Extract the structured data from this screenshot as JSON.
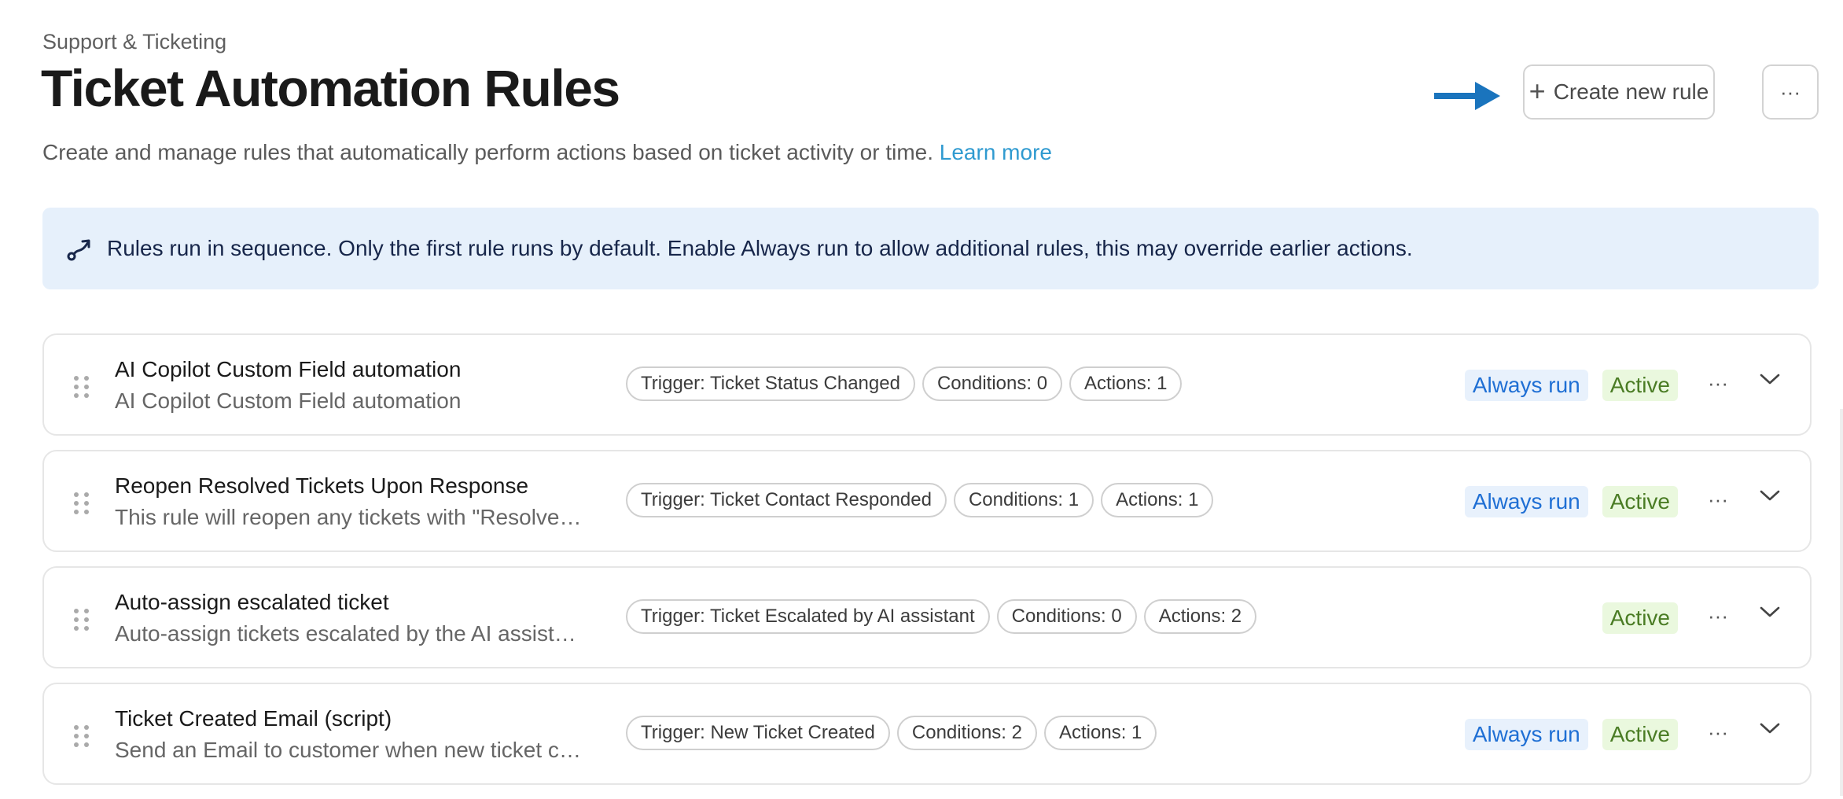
{
  "header": {
    "breadcrumb": "Support & Ticketing",
    "title": "Ticket Automation Rules",
    "subtitle": "Create and manage rules that automatically perform actions based on ticket activity or time.",
    "learn_more": "Learn more",
    "create_button": "Create new rule",
    "more_button": "···"
  },
  "banner": {
    "text": "Rules run in sequence. Only the first rule runs by default. Enable Always run to allow additional rules, this may override earlier actions."
  },
  "rules": [
    {
      "name": "AI Copilot Custom Field automation",
      "description": "AI Copilot Custom Field automation",
      "trigger": "Trigger: Ticket Status Changed",
      "conditions": "Conditions: 0",
      "actions": "Actions: 1",
      "always_run": "Always run",
      "status": "Active"
    },
    {
      "name": "Reopen Resolved Tickets Upon Response",
      "description": "This rule will reopen any tickets with \"Resolved…",
      "trigger": "Trigger: Ticket Contact Responded",
      "conditions": "Conditions: 1",
      "actions": "Actions: 1",
      "always_run": "Always run",
      "status": "Active"
    },
    {
      "name": "Auto-assign escalated ticket",
      "description": "Auto-assign tickets escalated by the AI assista…",
      "trigger": "Trigger: Ticket Escalated by AI assistant",
      "conditions": "Conditions: 0",
      "actions": "Actions: 2",
      "always_run": "",
      "status": "Active"
    },
    {
      "name": "Ticket Created Email (script)",
      "description": "Send an Email to customer when new ticket cr…",
      "trigger": "Trigger: New Ticket Created",
      "conditions": "Conditions: 2",
      "actions": "Actions: 1",
      "always_run": "Always run",
      "status": "Active"
    }
  ],
  "row_more_label": "···",
  "colors": {
    "accent_link": "#2f9ad0",
    "arrow": "#1a74bd",
    "banner_bg": "#e6f0fb",
    "always_run": "#1f6fd4",
    "active": "#4a7c24"
  }
}
